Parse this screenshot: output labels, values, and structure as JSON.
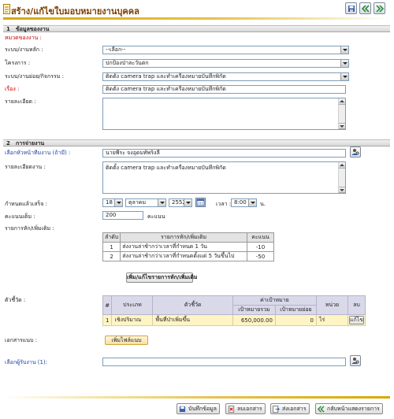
{
  "header": {
    "title": "สร้าง/แก้ไขใบมอบหมายงานบุคคล",
    "buttons": [
      "save-icon",
      "back-icon",
      "forward-icon"
    ]
  },
  "section1": {
    "number": "1",
    "title": "ข้อมูลของงาน",
    "category_label": "หมวดของงาน :",
    "main_system_label": "ระบบ/งานหลัก :",
    "main_system_value": "--เลือก--",
    "project_label": "โครงการ :",
    "project_value": "ปกป้องป่าละวันตก",
    "sub_system_label": "ระบบ/งานย่อย/กิจกรรม :",
    "sub_system_value": "ติดตั้ง camera trap และทำเครื่องหมายบันทึกพิกัด",
    "subject_label": "เรื่อง :",
    "subject_value": "ติดตั้ง camera trap และทำเครื่องหมายบันทึกพิกัด",
    "detail_label": "รายละเอียด :",
    "detail_value": ""
  },
  "section2": {
    "number": "2",
    "title": "การจ่ายงาน",
    "team_lead_label": "เลือกหัวหน้าทีมงาน (ถ้ามี) :",
    "team_lead_value": "นายพีระ จงอุดมทัพริงลี",
    "work_detail_label": "รายละเอียดงาน :",
    "work_detail_value": "ติดตั้ง camera trap และทำเครื่องหมายบันทึกพิกัด",
    "deadline_label": "กำหนดแล้วเสร็จ :",
    "deadline_day": "18",
    "deadline_month": "ตุลาคม",
    "deadline_year": "2552",
    "time_label": "เวลา :",
    "time_value": "8:00",
    "time_unit": "น.",
    "full_score_label": "คะแนนเต็ม :",
    "full_score_value": "200",
    "score_unit": "คะแนน",
    "deduction_label": "รายการหัก/เพิ่มเติม :",
    "deduction_table": {
      "headers": [
        "ลำดับ",
        "รายการหัก/เพิ่มเติม",
        "คะแนน"
      ],
      "rows": [
        [
          "1",
          "ส่งงานล่าช้ากว่าเวลาที่กำหนด 1 วัน",
          "-10"
        ],
        [
          "2",
          "ส่งงานล่าช้ากว่าเวลาที่กำหนดตั้งแต่ 5 วันขึ้นไป",
          "-50"
        ]
      ]
    },
    "deduction_button": "เพิ่ม/แก้ไขรายการหัก/เพิ่มเติม",
    "indicator_label": "ตัวชี้วัด :",
    "indicator_table": {
      "headers": {
        "no": "#",
        "type": "ประเภท",
        "indicator": "ตัวชี้วัด",
        "target_group": "ค่าเป้าหมาย",
        "target_total": "เป้าหมายรวม",
        "target_sub": "เป้าหมายย่อย",
        "unit": "หน่วย",
        "delete": "ลบ"
      },
      "rows": [
        {
          "no": "1",
          "type": "เชิงปริมาณ",
          "indicator": "พื้นที่ป่าเพิ่มขึ้น",
          "target_total": "650,000.00",
          "target_sub": "0",
          "unit": "ไร่",
          "action": "แก้ไข"
        }
      ]
    },
    "attachment_label": "เอกสารแนบ :",
    "attachment_button": "เพิ่มไฟล์แนบ",
    "receiver_label": "เลือกผู้รับงาน (1):",
    "receiver_value": ""
  },
  "footer": {
    "save": "บันทึกข้อมูล",
    "delete": "ลบเอกสาร",
    "send": "ส่งเอกสาร",
    "back": "กลับหน้าแสดงรายการ"
  },
  "colors": {
    "accent_gold": "#d7a800",
    "title_brown": "#7a3d00",
    "required_red": "#cc0000",
    "link_blue": "#1c3ea8",
    "indicator_row": "#fff4c4"
  }
}
